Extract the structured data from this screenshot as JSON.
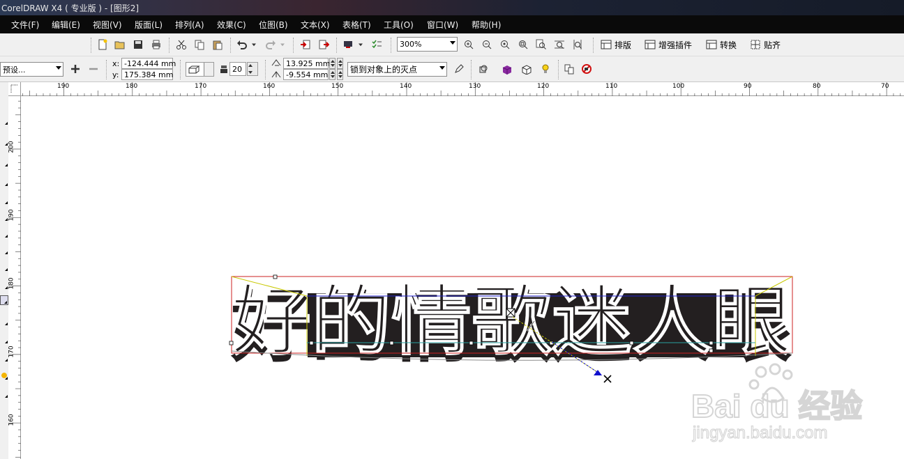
{
  "window": {
    "title": "CorelDRAW X4 ( 专业版 ) - [图形2]"
  },
  "menu": [
    "文件(F)",
    "编辑(E)",
    "视图(V)",
    "版面(L)",
    "排列(A)",
    "效果(C)",
    "位图(B)",
    "文本(X)",
    "表格(T)",
    "工具(O)",
    "窗口(W)",
    "帮助(H)"
  ],
  "toolbar": {
    "zoom_value": "300%",
    "layout_label": "排版",
    "plugin_label": "增强插件",
    "convert_label": "转换",
    "snap_label": "贴齐"
  },
  "property_bar": {
    "preset_value": "预设...",
    "x_label": "x:",
    "x_value": "-124.444 mm",
    "y_label": "y:",
    "y_value": "175.384 mm",
    "depth_value": "20",
    "vp_x_value": "13.925 mm",
    "vp_y_value": "-9.554 mm",
    "vanish_lock_value": "锁到对象上的灭点"
  },
  "ruler": {
    "h_labels": [
      "190",
      "180",
      "170",
      "160",
      "150",
      "140",
      "130",
      "120",
      "110",
      "100",
      "90",
      "80",
      "70"
    ],
    "v_labels": [
      "200",
      "190",
      "180",
      "170",
      "160"
    ]
  },
  "canvas": {
    "text": "好的情歌迷人眼",
    "watermark_main": "Bai du 经验",
    "watermark_url": "jingyan.baidu.com"
  },
  "colors": {
    "extrude_fill": "#231f20",
    "selection_red": "#cc2222",
    "bbox_yellow": "#c8c800",
    "vanish_blue": "#1010cc"
  }
}
